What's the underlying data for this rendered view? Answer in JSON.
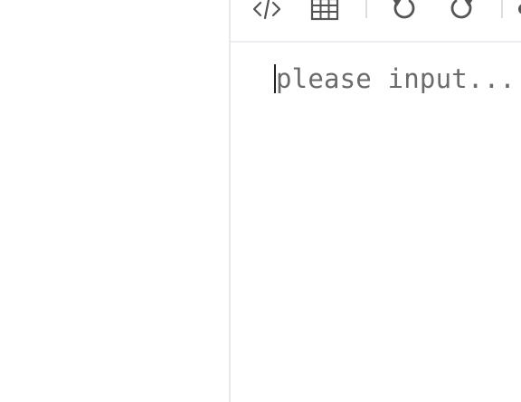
{
  "toolbar": {
    "items": [
      {
        "icon": "code-icon"
      },
      {
        "icon": "table-icon"
      },
      {
        "icon": "undo-icon"
      },
      {
        "icon": "redo-icon"
      },
      {
        "icon": "more-icon"
      }
    ],
    "icon_color": "#555555"
  },
  "editor": {
    "placeholder": "please input..."
  }
}
